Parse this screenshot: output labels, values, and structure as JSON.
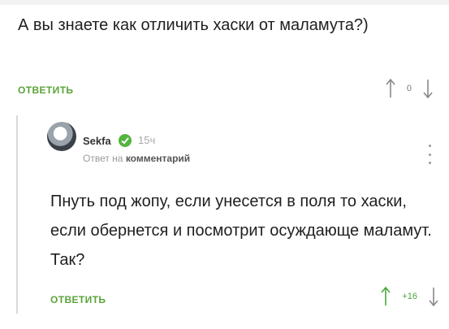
{
  "comment": {
    "text": "А вы знаете как отличить хаски от маламута?)",
    "reply_label": "ОТВЕТИТЬ",
    "rating": "0"
  },
  "reply": {
    "author": "Sekfa",
    "time": "15ч",
    "reply_to_prefix": "Ответ на",
    "reply_to_target": "комментарий",
    "text": "Пнуть под жопу, если унесется в поля то хаски, если обернется и посмотрит осуждающе маламут. Так?",
    "reply_label": "ОТВЕТИТЬ",
    "rating": "+16"
  },
  "icons": {
    "upvote": "arrow-up-icon",
    "downvote": "arrow-down-icon",
    "more": "more-vertical-icon",
    "verified": "check-icon"
  },
  "colors": {
    "accent_green": "#5aa33a",
    "rating_positive": "#4aa63a",
    "muted": "#9a9a9a"
  }
}
